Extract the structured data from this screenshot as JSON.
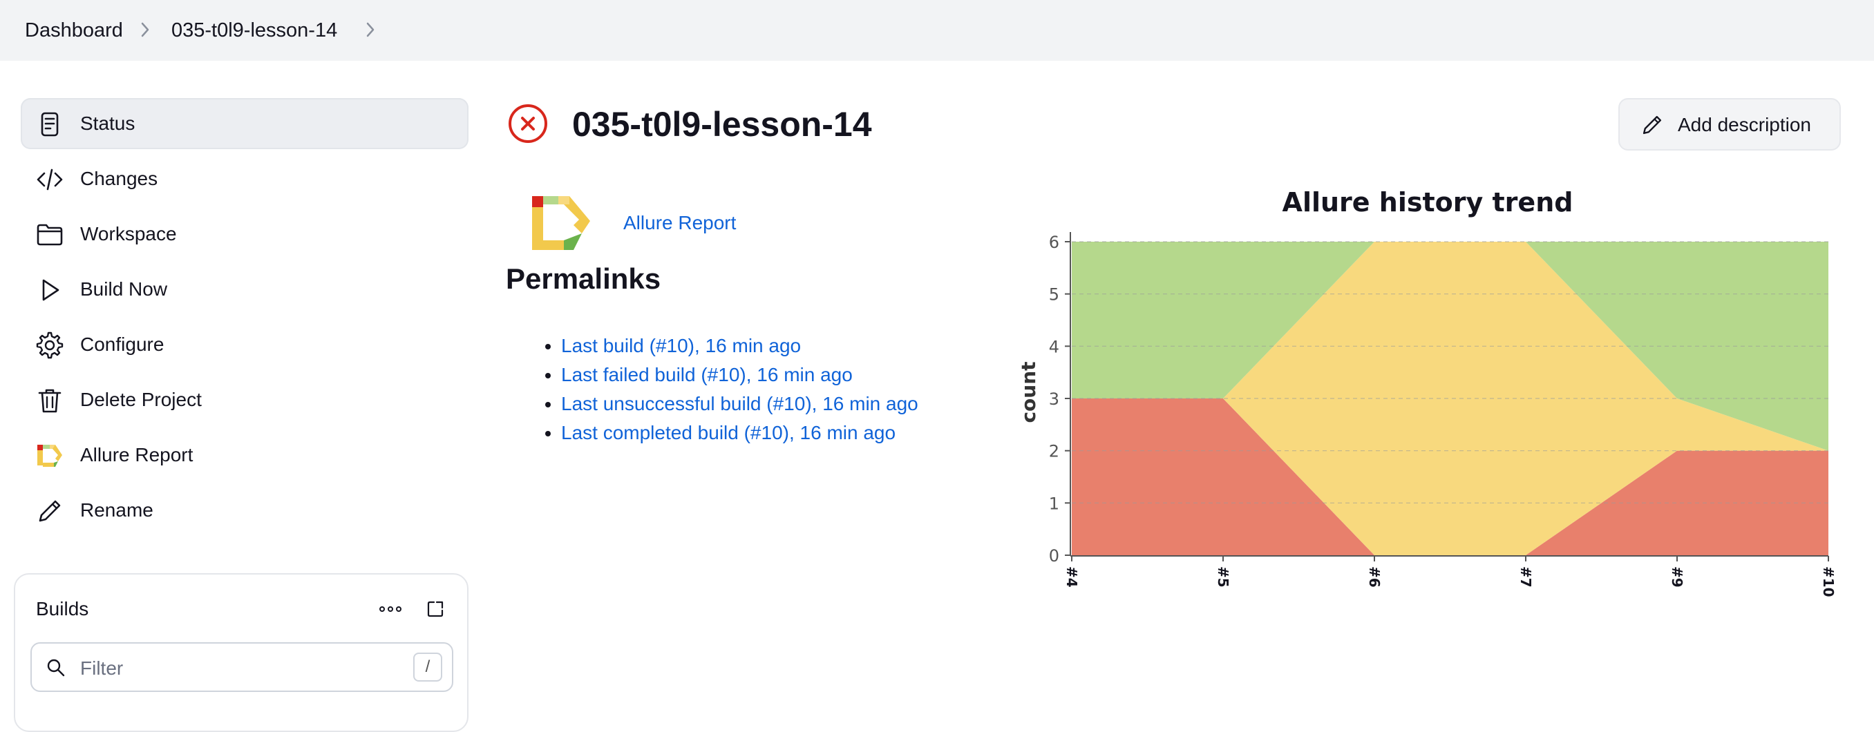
{
  "breadcrumb": [
    "Dashboard",
    "035-t0l9-lesson-14"
  ],
  "sidebar": {
    "items": [
      {
        "label": "Status",
        "icon": "status-document-icon",
        "active": true
      },
      {
        "label": "Changes",
        "icon": "code-icon"
      },
      {
        "label": "Workspace",
        "icon": "folder-icon"
      },
      {
        "label": "Build Now",
        "icon": "play-icon"
      },
      {
        "label": "Configure",
        "icon": "gear-icon"
      },
      {
        "label": "Delete Project",
        "icon": "trash-icon"
      },
      {
        "label": "Allure Report",
        "icon": "allure-logo-icon"
      },
      {
        "label": "Rename",
        "icon": "pencil-icon"
      }
    ]
  },
  "builds": {
    "title": "Builds",
    "filter_placeholder": "Filter",
    "shortcut": "/"
  },
  "main": {
    "title": "035-t0l9-lesson-14",
    "status": "failed",
    "add_description": "Add description",
    "allure_link": "Allure Report",
    "permalinks_heading": "Permalinks",
    "permalinks": [
      "Last build (#10), 16 min ago",
      "Last failed build (#10), 16 min ago",
      "Last unsuccessful build (#10), 16 min ago",
      "Last completed build (#10), 16 min ago"
    ]
  },
  "colors": {
    "failed": "#e8806c",
    "broken": "#f8d97e",
    "passed": "#b5d88c",
    "link": "#1063d8",
    "error_icon": "#d8271c"
  },
  "chart_data": {
    "type": "area",
    "stacked": true,
    "title": "Allure history trend",
    "xlabel": "",
    "ylabel": "count",
    "categories": [
      "#4",
      "#5",
      "#6",
      "#7",
      "#9",
      "#10"
    ],
    "yticks": [
      0,
      1,
      2,
      3,
      4,
      5,
      6
    ],
    "ylim": [
      0,
      6
    ],
    "grid": true,
    "legend": "none",
    "series": [
      {
        "color": "#e8806c",
        "values": [
          3,
          3,
          0,
          0,
          2,
          2
        ]
      },
      {
        "color": "#f8d97e",
        "values": [
          0,
          0,
          6,
          6,
          1,
          0
        ]
      },
      {
        "color": "#b5d88c",
        "values": [
          3,
          3,
          0,
          0,
          3,
          4
        ]
      }
    ]
  }
}
